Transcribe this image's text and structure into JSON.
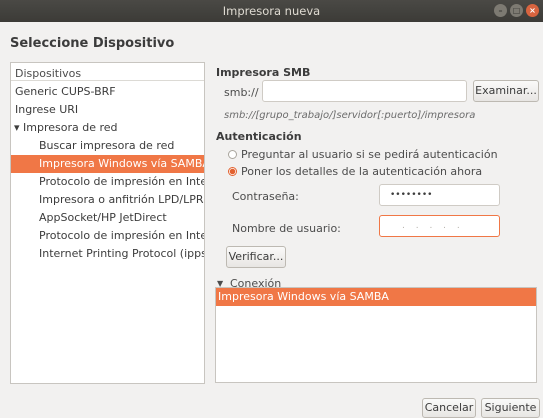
{
  "window": {
    "title": "Impresora nueva"
  },
  "page": {
    "heading": "Seleccione Dispositivo"
  },
  "devices": {
    "header": "Dispositivos",
    "items": [
      {
        "label": "Generic CUPS-BRF",
        "indent": 0,
        "selected": false
      },
      {
        "label": "Ingrese URI",
        "indent": 0,
        "selected": false
      },
      {
        "label": "▾ Impresora de red",
        "indent": 0,
        "selected": false
      },
      {
        "label": "Buscar impresora de red",
        "indent": 1,
        "selected": false
      },
      {
        "label": "Impresora Windows vía SAMBA",
        "indent": 1,
        "selected": true
      },
      {
        "label": "Protocolo de impresión en Interr",
        "indent": 1,
        "selected": false
      },
      {
        "label": "Impresora o anfitrión LPD/LPR",
        "indent": 1,
        "selected": false
      },
      {
        "label": "AppSocket/HP JetDirect",
        "indent": 1,
        "selected": false
      },
      {
        "label": "Protocolo de impresión en Interr",
        "indent": 1,
        "selected": false
      },
      {
        "label": "Internet Printing Protocol (ipps)",
        "indent": 1,
        "selected": false
      }
    ]
  },
  "smb": {
    "section_title": "Impresora SMB",
    "prefix": "smb://",
    "uri_value": "",
    "browse_label": "Examinar...",
    "hint": "smb://[grupo_trabajo/]servidor[:puerto]/impresora"
  },
  "auth": {
    "section_title": "Autenticación",
    "option_prompt": "Preguntar al usuario si se pedirá autenticación",
    "option_now": "Poner los detalles de la autenticación ahora",
    "selected_option": "now",
    "password_label": "Contraseña:",
    "password_value": "••••••••",
    "username_label": "Nombre de usuario:",
    "username_value": ". . . . .",
    "verify_label": "Verificar..."
  },
  "connection": {
    "title": "Conexión",
    "items": [
      "Impresora Windows vía SAMBA"
    ]
  },
  "footer": {
    "cancel_label": "Cancelar",
    "next_label": "Siguiente"
  },
  "colors": {
    "accent": "#f07746",
    "titlebar": "#3c3b37"
  }
}
